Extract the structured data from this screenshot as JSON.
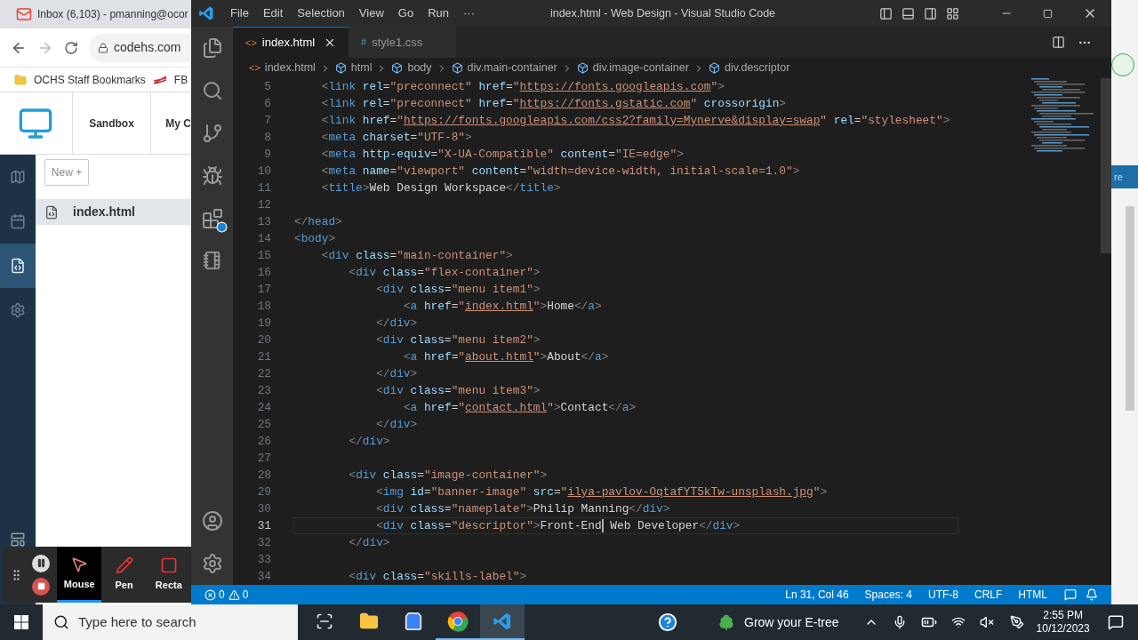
{
  "browser": {
    "tab_title": "Inbox (6,103) - pmanning@ocor",
    "url": "codehs.com",
    "bookmarks": [
      "OCHS Staff Bookmarks",
      "FB"
    ],
    "nav": [
      "Sandbox",
      "My C"
    ],
    "sidebar": [
      {
        "kind": "map",
        "selected": false
      },
      {
        "kind": "calendar",
        "selected": false
      },
      {
        "kind": "code",
        "selected": true
      },
      {
        "kind": "settings",
        "selected": false
      }
    ],
    "new_button": "New +",
    "files": [
      {
        "name": "index.html",
        "selected": true
      }
    ]
  },
  "recorder": {
    "tools": [
      {
        "kind": "mouse",
        "label": "Mouse",
        "selected": true
      },
      {
        "kind": "pen",
        "label": "Pen",
        "selected": false
      },
      {
        "kind": "rectangle",
        "label": "Recta",
        "selected": false
      }
    ]
  },
  "vscode": {
    "menu": [
      "File",
      "Edit",
      "Selection",
      "View",
      "Go",
      "Run",
      "···"
    ],
    "title": "index.html - Web Design - Visual Studio Code",
    "tabs": [
      {
        "kind": "html",
        "glyph": "<>",
        "label": "index.html",
        "selected": true
      },
      {
        "kind": "css",
        "glyph": "#",
        "label": "style1.css",
        "selected": false
      }
    ],
    "breadcrumbs": [
      {
        "kind": "file",
        "glyph": "<>",
        "label": "index.html"
      },
      {
        "kind": "element",
        "label": "html"
      },
      {
        "kind": "element",
        "label": "body"
      },
      {
        "kind": "element",
        "label": "div.main-container"
      },
      {
        "kind": "element",
        "label": "div.image-container"
      },
      {
        "kind": "element",
        "label": "div.descriptor"
      }
    ],
    "lines": [
      {
        "number": "5",
        "current": false,
        "segments": [
          {
            "kind": "code",
            "text": "    <link rel=\"preconnect\" href=\""
          },
          {
            "kind": "link",
            "text": "https://fonts.googleapis.com"
          },
          {
            "kind": "code",
            "text": "\">"
          }
        ]
      },
      {
        "number": "6",
        "current": false,
        "segments": [
          {
            "kind": "code",
            "text": "    <link rel=\"preconnect\" href=\""
          },
          {
            "kind": "link",
            "text": "https://fonts.gstatic.com"
          },
          {
            "kind": "code",
            "text": "\" crossorigin>"
          }
        ]
      },
      {
        "number": "7",
        "current": false,
        "segments": [
          {
            "kind": "code",
            "text": "    <link href=\""
          },
          {
            "kind": "link",
            "text": "https://fonts.googleapis.com/css2?family=Mynerve&display=swap"
          },
          {
            "kind": "code",
            "text": "\" rel=\"stylesheet\">"
          }
        ]
      },
      {
        "number": "8",
        "current": false,
        "segments": [
          {
            "kind": "code",
            "text": "    <meta charset=\"UTF-8\">"
          }
        ]
      },
      {
        "number": "9",
        "current": false,
        "segments": [
          {
            "kind": "code",
            "text": "    <meta http-equiv=\"X-UA-Compatible\" content=\"IE=edge\">"
          }
        ]
      },
      {
        "number": "10",
        "current": false,
        "segments": [
          {
            "kind": "code",
            "text": "    <meta name=\"viewport\" content=\"width=device-width, initial-scale=1.0\">"
          }
        ]
      },
      {
        "number": "11",
        "current": false,
        "segments": [
          {
            "kind": "code",
            "text": "    <title>Web Design Workspace</title>"
          }
        ]
      },
      {
        "number": "12",
        "current": false
      },
      {
        "number": "13",
        "current": false,
        "segments": [
          {
            "kind": "code",
            "text": "</head>"
          }
        ]
      },
      {
        "number": "14",
        "current": false,
        "segments": [
          {
            "kind": "code",
            "text": "<body>"
          }
        ]
      },
      {
        "number": "15",
        "current": false,
        "segments": [
          {
            "kind": "code",
            "text": "    <div class=\"main-container\">"
          }
        ]
      },
      {
        "number": "16",
        "current": false,
        "segments": [
          {
            "kind": "code",
            "text": "        <div class=\"flex-container\">"
          }
        ]
      },
      {
        "number": "17",
        "current": false,
        "segments": [
          {
            "kind": "code",
            "text": "            <div class=\"menu item1\">"
          }
        ]
      },
      {
        "number": "18",
        "current": false,
        "segments": [
          {
            "kind": "code",
            "text": "                <a href=\""
          },
          {
            "kind": "link",
            "text": "index.html"
          },
          {
            "kind": "code",
            "text": "\">Home</a>"
          }
        ]
      },
      {
        "number": "19",
        "current": false,
        "segments": [
          {
            "kind": "code",
            "text": "            </div>"
          }
        ]
      },
      {
        "number": "20",
        "current": false,
        "segments": [
          {
            "kind": "code",
            "text": "            <div class=\"menu item2\">"
          }
        ]
      },
      {
        "number": "21",
        "current": false,
        "segments": [
          {
            "kind": "code",
            "text": "                <a href=\""
          },
          {
            "kind": "link",
            "text": "about.html"
          },
          {
            "kind": "code",
            "text": "\">About</a>"
          }
        ]
      },
      {
        "number": "22",
        "current": false,
        "segments": [
          {
            "kind": "code",
            "text": "            </div>"
          }
        ]
      },
      {
        "number": "23",
        "current": false,
        "segments": [
          {
            "kind": "code",
            "text": "            <div class=\"menu item3\">"
          }
        ]
      },
      {
        "number": "24",
        "current": false,
        "segments": [
          {
            "kind": "code",
            "text": "                <a href=\""
          },
          {
            "kind": "link",
            "text": "contact.html"
          },
          {
            "kind": "code",
            "text": "\">Contact</a>"
          }
        ]
      },
      {
        "number": "25",
        "current": false,
        "segments": [
          {
            "kind": "code",
            "text": "            </div>"
          }
        ]
      },
      {
        "number": "26",
        "current": false,
        "segments": [
          {
            "kind": "code",
            "text": "        </div>"
          }
        ]
      },
      {
        "number": "27",
        "current": false
      },
      {
        "number": "28",
        "current": false,
        "segments": [
          {
            "kind": "code",
            "text": "        <div class=\"image-container\">"
          }
        ]
      },
      {
        "number": "29",
        "current": false,
        "segments": [
          {
            "kind": "code",
            "text": "            <img id=\"banner-image\" src=\""
          },
          {
            "kind": "link",
            "text": "ilya-pavlov-OqtafYT5kTw-unsplash.jpg"
          },
          {
            "kind": "code",
            "text": "\">"
          }
        ]
      },
      {
        "number": "30",
        "current": false,
        "segments": [
          {
            "kind": "code",
            "text": "            <div class=\"nameplate\">Philip Manning</div>"
          }
        ]
      },
      {
        "number": "31",
        "current": true,
        "segments": [
          {
            "kind": "code",
            "text": "            <div class=\"descriptor\">Front-End"
          },
          {
            "kind": "cursor"
          },
          {
            "kind": "code",
            "text": " Web Developer</div>"
          }
        ]
      },
      {
        "number": "32",
        "current": false,
        "segments": [
          {
            "kind": "code",
            "text": "        </div>"
          }
        ]
      },
      {
        "number": "33",
        "current": false
      },
      {
        "number": "34",
        "current": false,
        "segments": [
          {
            "kind": "code",
            "text": "        <div class=\"skills-label\">"
          }
        ]
      }
    ],
    "status": {
      "errors": "0",
      "warnings": "0",
      "items": [
        "Ln 31, Col 46",
        "Spaces: 4",
        "UTF-8",
        "CRLF",
        "HTML"
      ]
    }
  },
  "right_edge": {
    "label": "re"
  },
  "taskbar": {
    "search_placeholder": "Type here to search",
    "apps": [
      {
        "kind": "taskview",
        "running": false,
        "selected": false
      },
      {
        "kind": "explorer",
        "running": false,
        "selected": false
      },
      {
        "kind": "store",
        "running": false,
        "selected": false
      },
      {
        "kind": "chrome",
        "running": true,
        "selected": false
      },
      {
        "kind": "vscode",
        "running": true,
        "selected": true
      }
    ],
    "widget": "Grow your E-tree",
    "time": "2:55 PM",
    "date": "10/12/2023"
  }
}
